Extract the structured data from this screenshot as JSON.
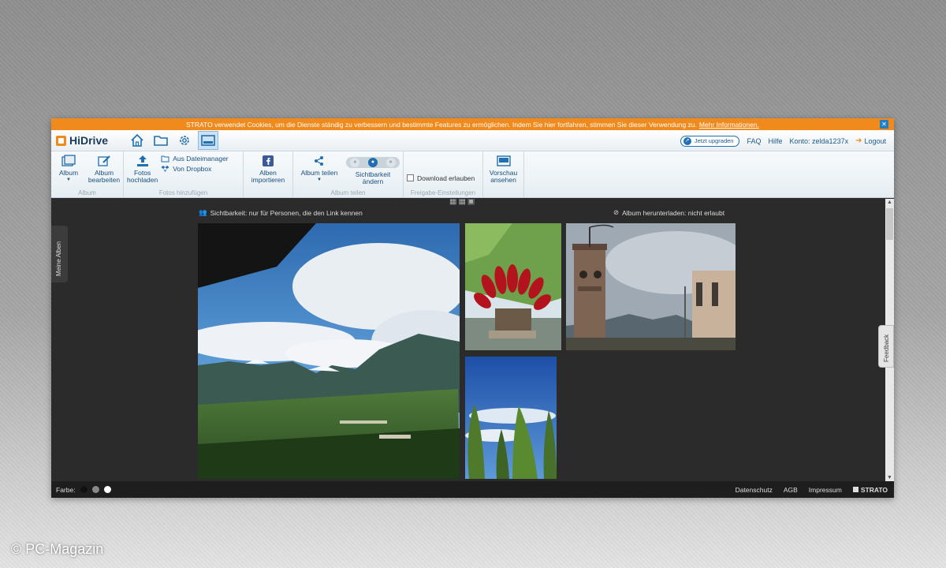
{
  "cookie_bar": {
    "text": "STRATO verwendet Cookies, um die Dienste ständig zu verbessern und bestimmte Features zu ermöglichen. Indem Sie hier fortfahren, stimmen Sie dieser Verwendung zu.",
    "link": "Mehr Informationen."
  },
  "topnav": {
    "logo": "HiDrive",
    "upgrade": "Jetzt upgraden",
    "faq": "FAQ",
    "help": "Hilfe",
    "account": "Konto: zelda1237x",
    "logout": "Logout"
  },
  "ribbon": {
    "album": {
      "label": "Album",
      "album_btn": "Album",
      "edit_btn_1": "Album",
      "edit_btn_2": "bearbeiten"
    },
    "upload": {
      "label": "Fotos hinzufügen",
      "upload_btn_1": "Fotos",
      "upload_btn_2": "hochladen",
      "from_files": "Aus Dateimanager",
      "from_dropbox": "Von Dropbox"
    },
    "import": {
      "btn_1": "Alben",
      "btn_2": "importieren"
    },
    "share": {
      "label": "Album teilen",
      "share_btn": "Album teilen",
      "visibility_1": "Sichtbarkeit",
      "visibility_2": "ändern"
    },
    "release": {
      "label": "Freigabe-Einstellungen",
      "download": "Download erlauben"
    },
    "preview": {
      "btn_1": "Vorschau",
      "btn_2": "ansehen"
    }
  },
  "stage": {
    "side_tab": "Meine Alben",
    "visibility_info": "Sichtbarkeit: nur für Personen, die den Link kennen",
    "download_info": "Album herunterladen: nicht erlaubt",
    "feedback": "Feedback"
  },
  "footer": {
    "color_label": "Farbe:",
    "swatches": [
      "#111111",
      "#888888",
      "#ffffff"
    ],
    "privacy": "Datenschutz",
    "agb": "AGB",
    "imprint": "Impressum",
    "brand": "STRATO"
  },
  "watermark": "© PC-Magazin",
  "colors": {
    "accent": "#f08a1c",
    "link": "#1b5a8e",
    "stage_bg": "#2b2b2b"
  }
}
